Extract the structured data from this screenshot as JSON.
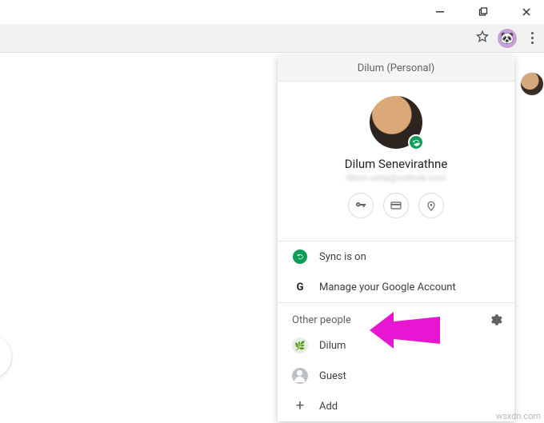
{
  "window": {
    "controls": {
      "minimize": "–",
      "maximize": "❐",
      "close": "✕"
    }
  },
  "toolbar": {
    "star_title": "Bookmark",
    "profile_title": "Profile",
    "menu_title": "Menu"
  },
  "profile_menu": {
    "header": "Dilum (Personal)",
    "name": "Dilum Senevirathne",
    "email_blurred": "dilum.sene@outlook.com",
    "chips": {
      "passwords": "Passwords",
      "payments": "Payment methods",
      "addresses": "Addresses"
    },
    "sync_label": "Sync is on",
    "manage_label": "Manage your Google Account",
    "other_people_label": "Other people",
    "settings_title": "Manage people",
    "people": [
      {
        "name": "Dilum"
      },
      {
        "name": "Guest"
      }
    ],
    "add_label": "Add"
  },
  "watermark": "wsxdn.com"
}
